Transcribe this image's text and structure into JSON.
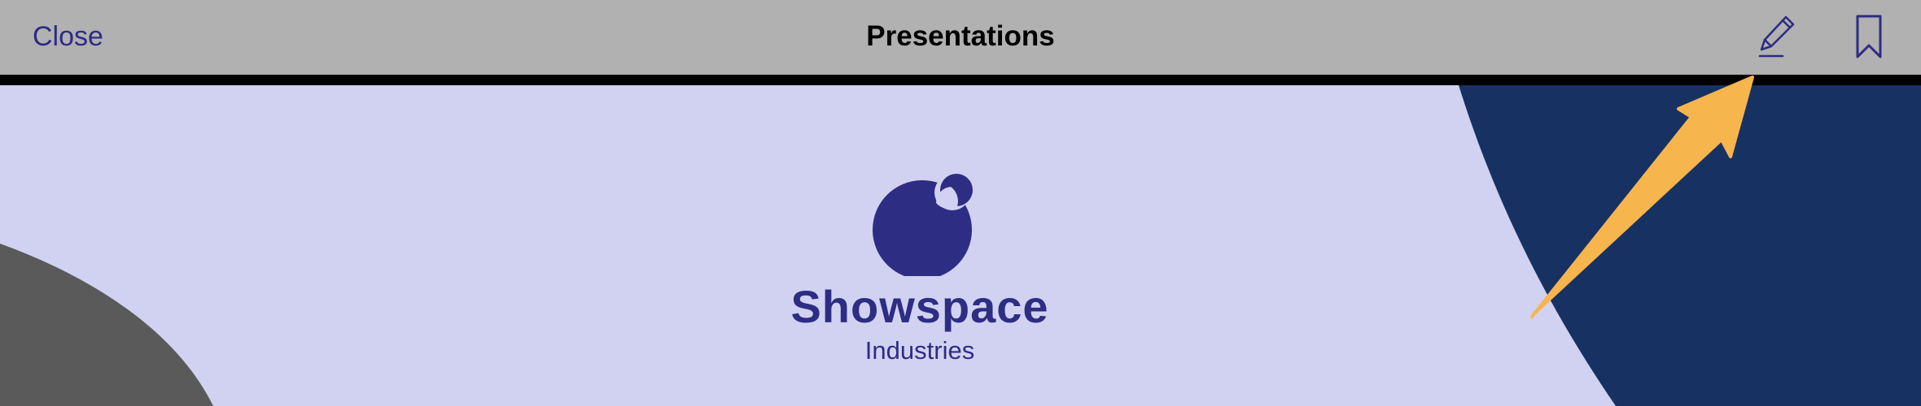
{
  "toolbar": {
    "close_label": "Close",
    "title": "Presentations",
    "edit_icon": "pencil-icon",
    "bookmark_icon": "bookmark-icon"
  },
  "slide": {
    "brand_name": "Showspace",
    "brand_subtitle": "Industries"
  },
  "colors": {
    "toolbar_bg": "#b1b1b1",
    "accent_text": "#2c2c84",
    "slide_bg": "#d1d2f1",
    "navy_shape": "#173163",
    "gray_shape": "#5a5a5a",
    "logo": "#2e2d84",
    "annotation_arrow": "#f6b54d"
  }
}
